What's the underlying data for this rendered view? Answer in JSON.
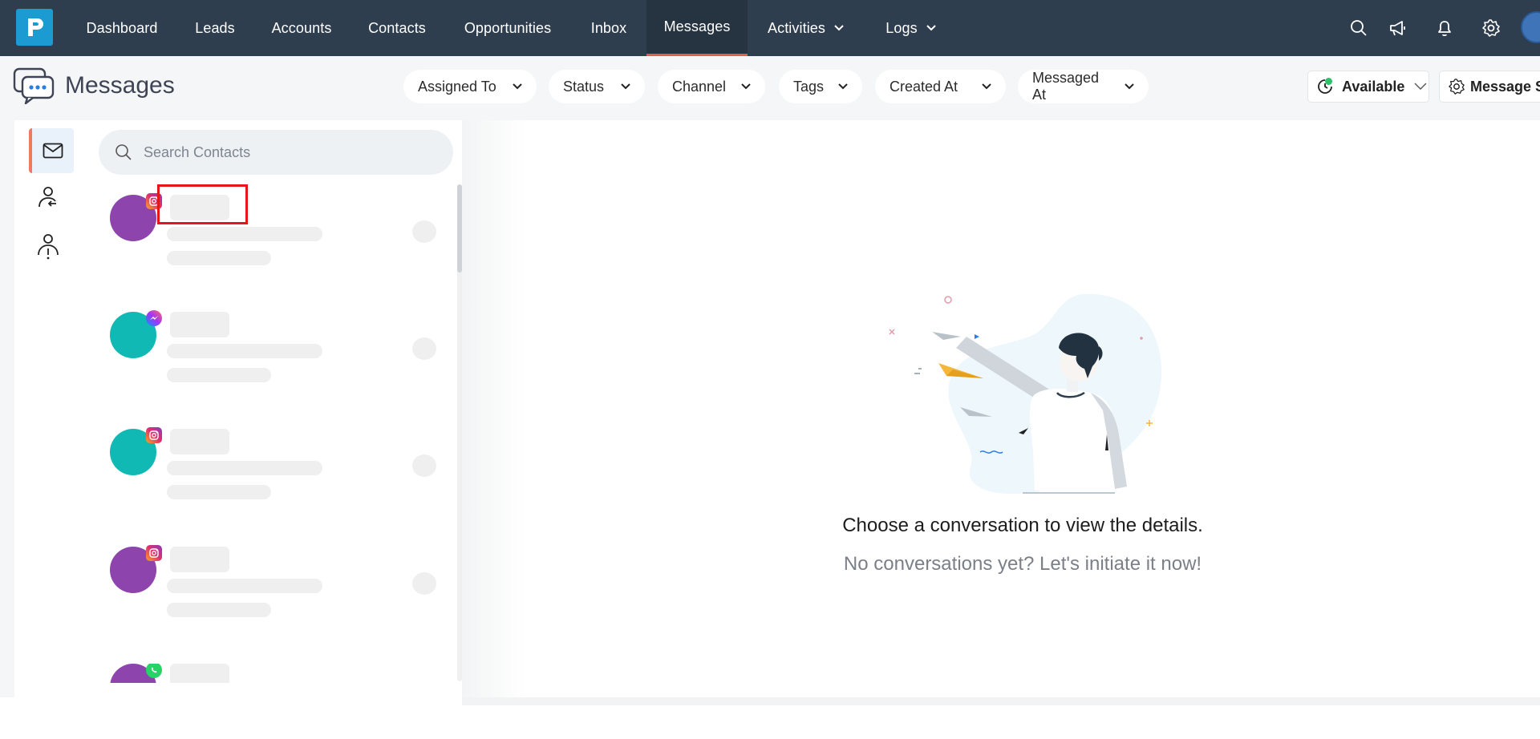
{
  "nav": {
    "items": [
      {
        "label": "Dashboard"
      },
      {
        "label": "Leads"
      },
      {
        "label": "Accounts"
      },
      {
        "label": "Contacts"
      },
      {
        "label": "Opportunities"
      },
      {
        "label": "Inbox"
      },
      {
        "label": "Messages",
        "active": true
      },
      {
        "label": "Activities",
        "dropdown": true
      },
      {
        "label": "Logs",
        "dropdown": true
      }
    ],
    "icons": [
      "search-icon",
      "megaphone-icon",
      "bell-icon",
      "gear-icon"
    ],
    "accent": "#e2603e",
    "background": "#2f3e4e"
  },
  "header": {
    "title": "Messages",
    "filters": [
      "Assigned To",
      "Status",
      "Channel",
      "Tags",
      "Created At",
      "Messaged At"
    ],
    "availability": "Available",
    "settings_label": "Message Se"
  },
  "search": {
    "placeholder": "Search Contacts"
  },
  "rail": {
    "icons": [
      "envelope-icon",
      "person-assigned-icon",
      "person-unassigned-icon"
    ]
  },
  "contacts": [
    {
      "avatar_color": "#8e44ad",
      "channel": "instagram-icon"
    },
    {
      "avatar_color": "#10b9b3",
      "channel": "messenger-icon"
    },
    {
      "avatar_color": "#10b9b3",
      "channel": "instagram-icon"
    },
    {
      "avatar_color": "#8e44ad",
      "channel": "instagram-icon"
    },
    {
      "avatar_color": "#8e44ad",
      "channel": "whatsapp-icon"
    }
  ],
  "empty_state": {
    "title": "Choose a conversation to view the details.",
    "subtitle": "No conversations yet? Let's initiate it now!"
  }
}
